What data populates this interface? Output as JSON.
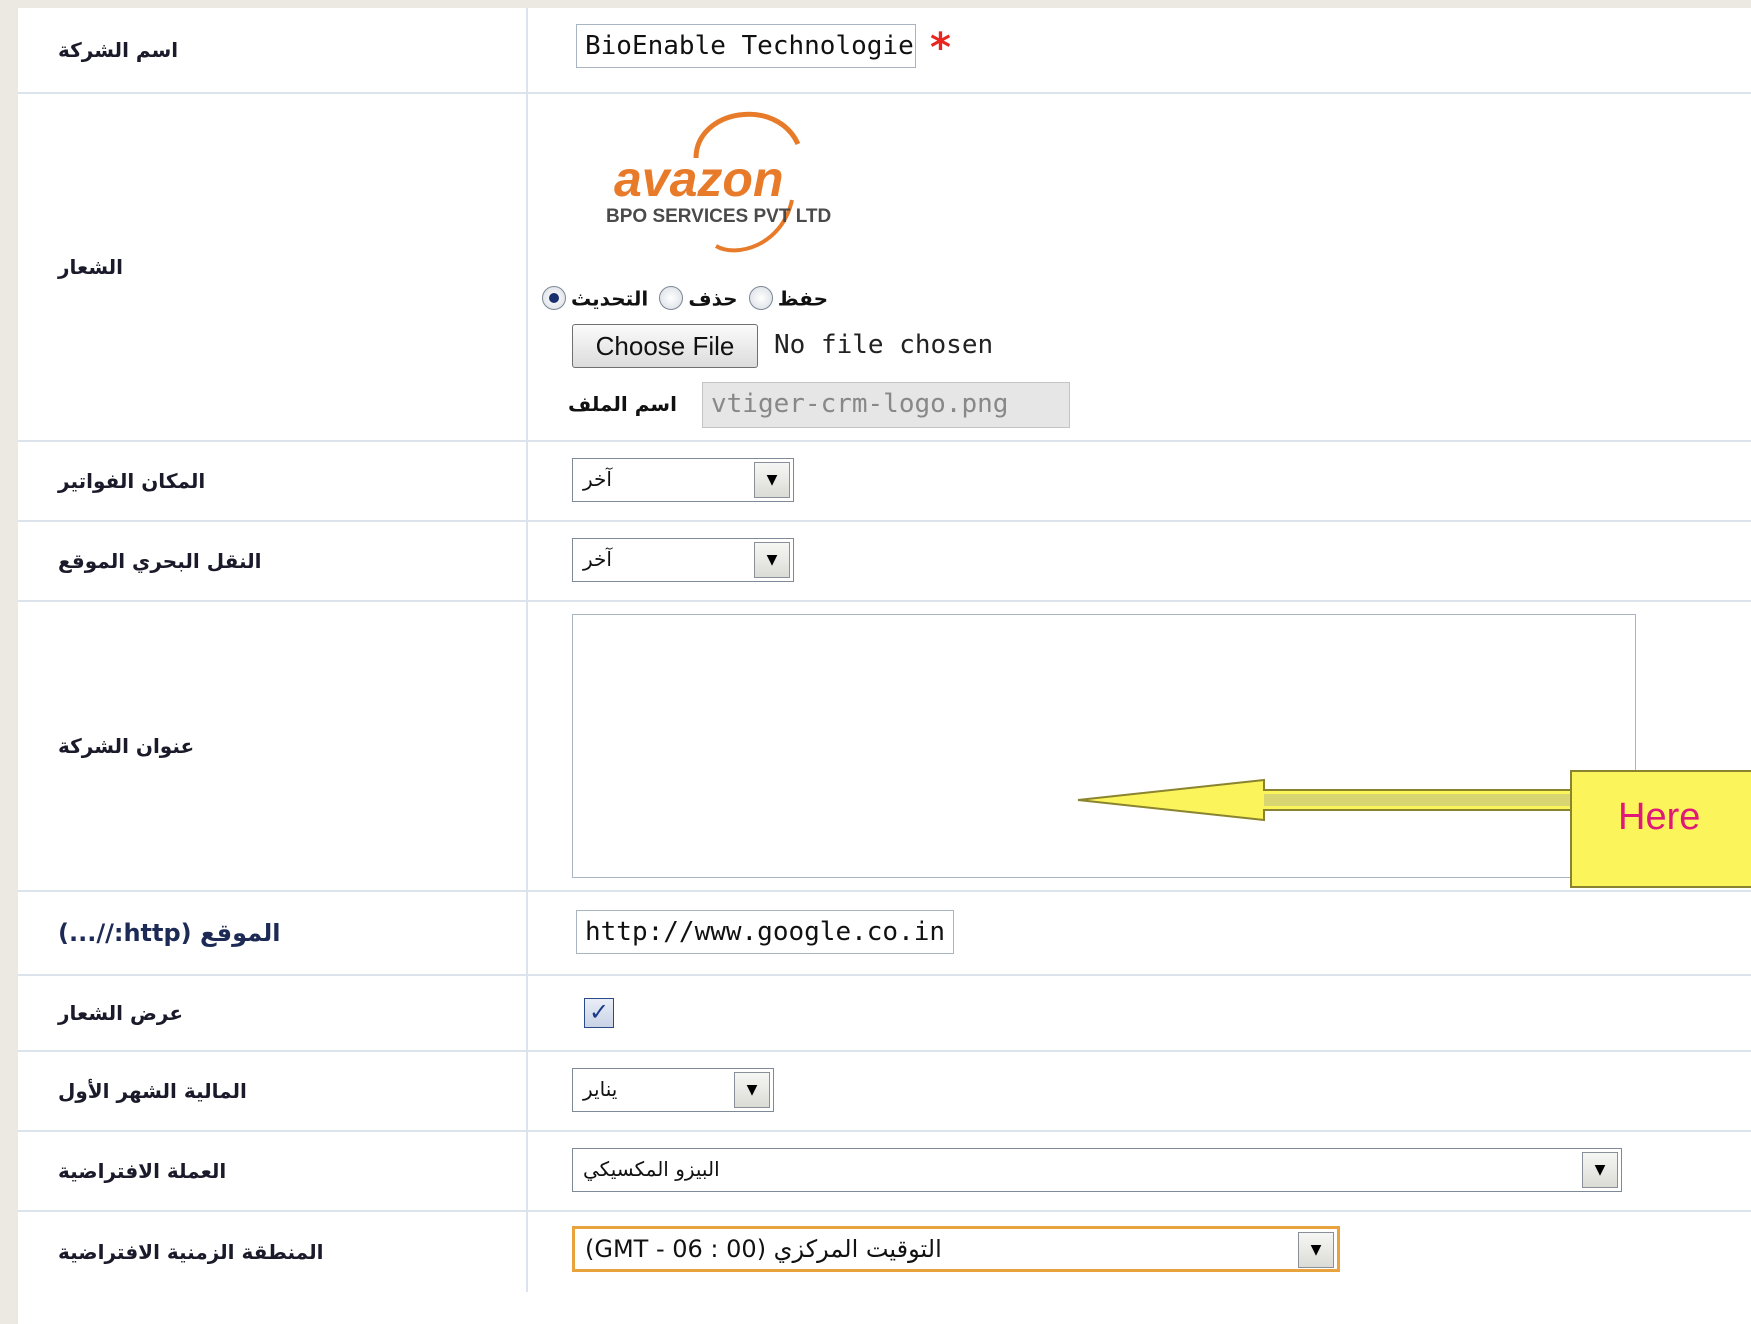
{
  "rows": {
    "company_name": {
      "label": "اسم الشركة",
      "value": "BioEnable Technologies",
      "required_mark": "*"
    },
    "logo": {
      "label": "الشعار",
      "logo_text": {
        "main": "avazon",
        "sub": "BPO SERVICES PVT LTD"
      },
      "radio_options": [
        {
          "label": "حفظ",
          "selected": false
        },
        {
          "label": "حذف",
          "selected": false
        },
        {
          "label": "التحديث",
          "selected": true
        }
      ],
      "choose_file_label": "Choose File",
      "no_file_text": "No file chosen",
      "filename_label": "اسم الملف",
      "filename_value": "vtiger-crm-logo.png"
    },
    "invoice_place": {
      "label": "المكان الفواتير",
      "selected": "آخر"
    },
    "shipping_place": {
      "label": "النقل البحري الموقع",
      "selected": "آخر"
    },
    "company_address": {
      "label": "عنوان الشركة",
      "value": ""
    },
    "website": {
      "label": "الموقع (http://...)",
      "value": "http://www.google.co.in"
    },
    "show_logo": {
      "label": "عرض الشعار",
      "checked": true,
      "check_glyph": "✓"
    },
    "fiscal_first_month": {
      "label": "المالية الشهر الأول",
      "selected": "يناير"
    },
    "default_currency": {
      "label": "العملة الافتراضية",
      "selected": "البيزو المكسيكي"
    },
    "default_timezone": {
      "label": "المنطقة الزمنية الافتراضية",
      "selected": "التوقيت المركزي (GMT - 06 : 00)"
    }
  },
  "annotation": {
    "callout_text": "Here"
  },
  "colors": {
    "required": "#e8251e",
    "callout_fill": "#fbf45a",
    "callout_text": "#e0187a",
    "logo_orange": "#e87b2a",
    "focus_border": "#e8a33c"
  },
  "icons": {
    "dropdown": "chevron-down-icon",
    "checkbox": "checkmark-icon",
    "arrow": "left-arrow-icon"
  }
}
